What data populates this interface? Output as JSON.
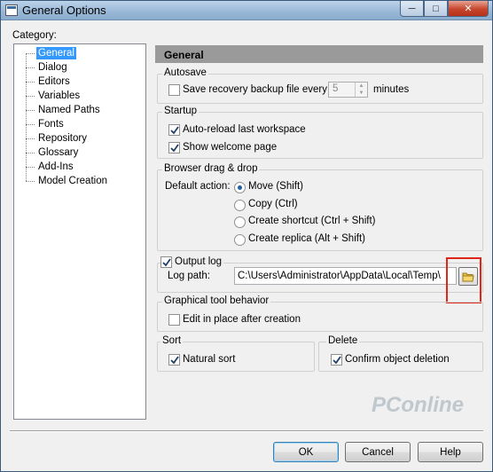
{
  "window": {
    "title": "General Options"
  },
  "category_label": "Category:",
  "tree": [
    "General",
    "Dialog",
    "Editors",
    "Variables",
    "Named Paths",
    "Fonts",
    "Repository",
    "Glossary",
    "Add-Ins",
    "Model Creation"
  ],
  "panel_title": "General",
  "autosave": {
    "title": "Autosave",
    "checkbox_label": "Save recovery backup file every",
    "checked": false,
    "interval_value": "5",
    "units": "minutes"
  },
  "startup": {
    "title": "Startup",
    "auto_reload_label": "Auto-reload last workspace",
    "auto_reload_checked": true,
    "welcome_label": "Show welcome page",
    "welcome_checked": true
  },
  "drag_drop": {
    "title": "Browser drag & drop",
    "default_action_label": "Default action:",
    "options": [
      {
        "label": "Move (Shift)",
        "selected": true
      },
      {
        "label": "Copy (Ctrl)",
        "selected": false
      },
      {
        "label": "Create shortcut (Ctrl + Shift)",
        "selected": false
      },
      {
        "label": "Create replica (Alt + Shift)",
        "selected": false
      }
    ]
  },
  "output_log": {
    "title": "Output log",
    "checked": true,
    "log_path_label": "Log path:",
    "log_path_value": "C:\\Users\\Administrator\\AppData\\Local\\Temp\\"
  },
  "graphical": {
    "title": "Graphical tool behavior",
    "edit_label": "Edit in place after creation",
    "edit_checked": false
  },
  "sort": {
    "title": "Sort",
    "natural_label": "Natural sort",
    "natural_checked": true
  },
  "delete": {
    "title": "Delete",
    "confirm_label": "Confirm object deletion",
    "confirm_checked": true
  },
  "buttons": {
    "ok": "OK",
    "cancel": "Cancel",
    "help": "Help"
  },
  "watermark": "PConline",
  "colors": {
    "selection": "#3399ff",
    "header": "#9a9a9a",
    "highlight_box": "#e0251a"
  }
}
